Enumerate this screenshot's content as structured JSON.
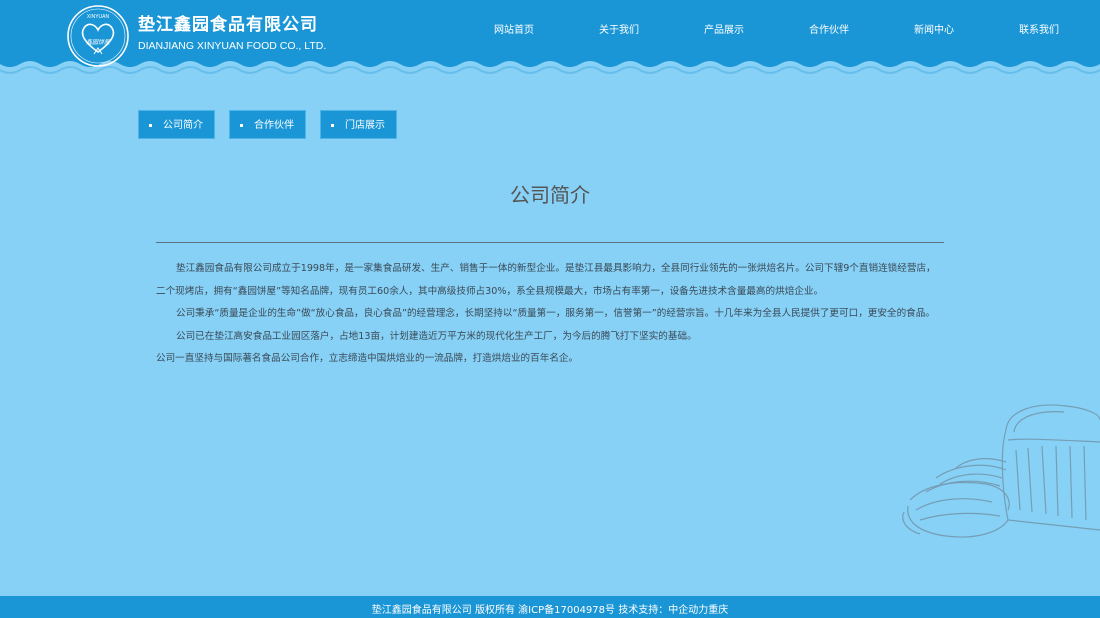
{
  "brand": {
    "name_cn": "垫江鑫园食品有限公司",
    "name_en": "DIANJIANG XINYUAN FOOD CO., LTD.",
    "logo_text_top": "XINYUAN",
    "logo_text_mid": "鑫园饼屋"
  },
  "nav": {
    "items": [
      {
        "label": "网站首页"
      },
      {
        "label": "关于我们"
      },
      {
        "label": "产品展示"
      },
      {
        "label": "合作伙伴"
      },
      {
        "label": "新闻中心"
      },
      {
        "label": "联系我们"
      }
    ]
  },
  "subnav": {
    "items": [
      {
        "label": "公司简介"
      },
      {
        "label": "合作伙伴"
      },
      {
        "label": "门店展示"
      }
    ]
  },
  "page": {
    "title": "公司简介",
    "paragraphs": [
      "垫江鑫园食品有限公司成立于1998年，是一家集食品研发、生产、销售于一体的新型企业。是垫江县最具影响力，全县同行业领先的一张烘焙名片。公司下辖9个直销连锁经营店，二个现烤店，拥有“鑫园饼屋”等知名品牌，现有员工60余人，其中高级技师占30%，系全县规模最大，市场占有率第一，设备先进技术含量最高的烘焙企业。",
      "公司秉承“质量是企业的生命”做“放心食品，良心食品”的经营理念，长期坚持以“质量第一，服务第一，信誉第一”的经营宗旨。十几年来为全县人民提供了更可口，更安全的食品。",
      "公司已在垫江高安食品工业园区落户，占地13亩，计划建造近万平方米的现代化生产工厂，为今后的腾飞打下坚实的基础。",
      "公司一直坚持与国际著名食品公司合作，立志缔造中国烘焙业的一流品牌，打造烘焙业的百年名企。"
    ]
  },
  "footer": {
    "text": "垫江鑫园食品有限公司 版权所有  渝ICP备17004978号  技术支持：中企动力重庆"
  },
  "colors": {
    "background": "#87d0f6",
    "header": "#1a96d6",
    "footer": "#1a96d6",
    "subnav": "#1a96d6",
    "text": "#3a4a55"
  },
  "icons": {
    "logo": "heart-logo-icon",
    "decoration": "bread-sketch-icon"
  }
}
